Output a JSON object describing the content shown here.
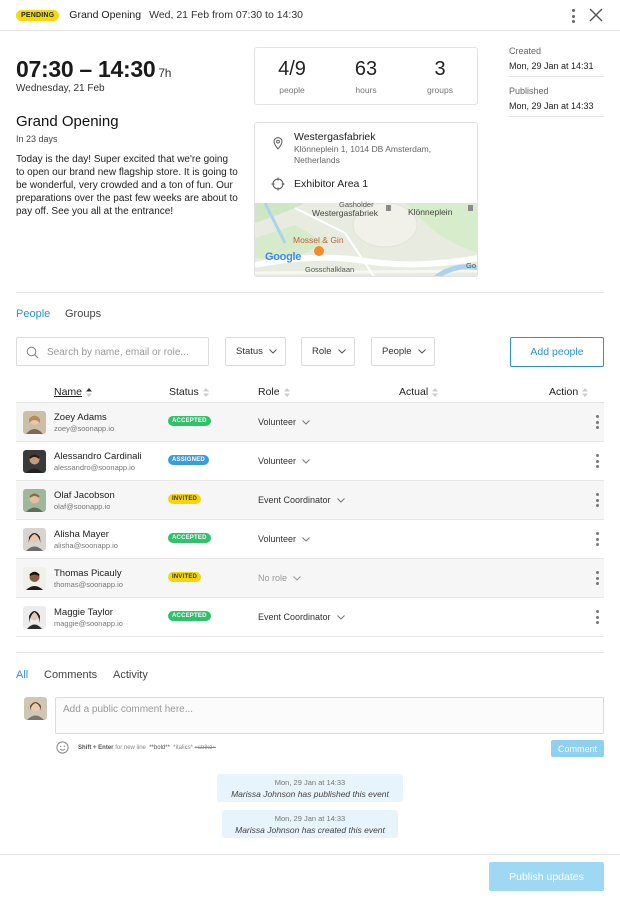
{
  "header": {
    "status_badge": "PENDING",
    "title": "Grand Opening",
    "date_text": "Wed, 21 Feb from 07:30 to 14:30"
  },
  "event": {
    "time_range": "07:30 – 14:30",
    "duration": "7h",
    "date_long": "Wednesday, 21 Feb",
    "title": "Grand Opening",
    "countdown": "In 23 days",
    "description": "Today is the day! Super excited that we're going to open our brand new flagship store. It is going to be wonderful, very crowded and a ton of fun. Our preparations over the past few weeks are about to pay off. See you all at the entrance!"
  },
  "stats": [
    {
      "value": "4/9",
      "label": "people"
    },
    {
      "value": "63",
      "label": "hours"
    },
    {
      "value": "3",
      "label": "groups"
    }
  ],
  "location": {
    "venue": "Westergasfabriek",
    "address": "Klönneplein 1, 1014 DB Amsterdam, Netherlands",
    "area": "Exhibitor Area 1",
    "map_labels": {
      "venue_a": "Gasholder",
      "venue_b": "Westergasfabriek",
      "square": "Klönneplein",
      "restaurant": "Mossel & Gin",
      "street": "Gosschalklaan",
      "brand": "Google",
      "edge": "Go"
    }
  },
  "meta": {
    "created_label": "Created",
    "created_value": "Mon, 29 Jan at 14:31",
    "published_label": "Published",
    "published_value": "Mon, 29 Jan at 14:33"
  },
  "tabs": {
    "people": "People",
    "groups": "Groups"
  },
  "filters": {
    "search_placeholder": "Search by name, email or role...",
    "status": "Status",
    "role": "Role",
    "people": "People",
    "add_people": "Add people"
  },
  "table": {
    "headers": {
      "name": "Name",
      "status": "Status",
      "role": "Role",
      "actual": "Actual",
      "action": "Action"
    },
    "rows": [
      {
        "name": "Zoey Adams",
        "email": "zoey@soonapp.io",
        "status": "ACCEPTED",
        "role": "Volunteer"
      },
      {
        "name": "Alessandro Cardinali",
        "email": "alessandro@soonapp.io",
        "status": "ASSIGNED",
        "role": "Volunteer"
      },
      {
        "name": "Olaf Jacobson",
        "email": "olaf@soonapp.io",
        "status": "INVITED",
        "role": "Event Coordinator"
      },
      {
        "name": "Alisha Mayer",
        "email": "alisha@soonapp.io",
        "status": "ACCEPTED",
        "role": "Volunteer"
      },
      {
        "name": "Thomas Picauly",
        "email": "thomas@soonapp.io",
        "status": "INVITED",
        "role": "No role"
      },
      {
        "name": "Maggie Taylor",
        "email": "maggie@soonapp.io",
        "status": "ACCEPTED",
        "role": "Event Coordinator"
      }
    ]
  },
  "comments": {
    "tabs": {
      "all": "All",
      "comments": "Comments",
      "activity": "Activity"
    },
    "placeholder": "Add a public comment here...",
    "hint_keys": "Shift + Enter",
    "hint_newline": "for new line",
    "hint_bold": "**bold**",
    "hint_italics": "*italics*",
    "hint_strike": "~strike~",
    "button": "Comment"
  },
  "activity": [
    {
      "time": "Mon, 29 Jan at 14:33",
      "text": "Marissa Johnson has published this event"
    },
    {
      "time": "Mon, 29 Jan at 14:33",
      "text": "Marissa Johnson has created this event"
    }
  ],
  "footer": {
    "publish": "Publish updates"
  },
  "colors": {
    "accent": "#2f8fd6",
    "accepted": "#2fc26a",
    "assigned": "#3a9be0",
    "invited": "#f5d50b",
    "pending": "#f5d90a"
  }
}
